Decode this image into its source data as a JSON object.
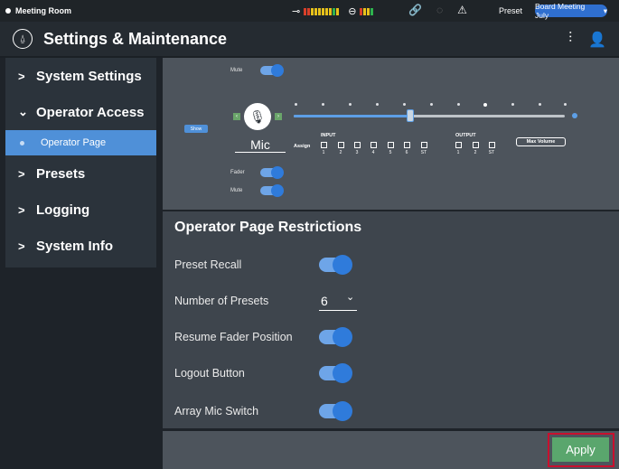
{
  "statusbar": {
    "room_name": "Meeting Room",
    "input_meter_icon": "input-arrow-icon",
    "output_meter_icon": "output-arrow-icon",
    "preset_label": "Preset",
    "preset_value": "Board Meeting July",
    "meter_colors": [
      "#e8c21b",
      "#d9402a",
      "#2fb34d"
    ]
  },
  "header": {
    "title": "Settings & Maintenance",
    "logo_glyph": "⍙"
  },
  "sidebar": {
    "items": [
      {
        "label": "System Settings",
        "chevron": ">"
      },
      {
        "label": "Operator Access",
        "chevron": "⌄"
      },
      {
        "label": "Operator Page"
      },
      {
        "label": "Presets",
        "chevron": ">"
      },
      {
        "label": "Logging",
        "chevron": ">"
      },
      {
        "label": "System Info",
        "chevron": ">"
      }
    ]
  },
  "mic_panel": {
    "mute_label": "Mute",
    "show_label": "Show",
    "mic_name": "Mic",
    "assign_label": "Assign",
    "input_label": "INPUT",
    "output_label": "OUTPUT",
    "input_channels": [
      "1",
      "2",
      "3",
      "4",
      "5",
      "6",
      "ST"
    ],
    "output_channels": [
      "1",
      "2",
      "ST"
    ],
    "max_volume_label": "Max Volume",
    "fader_label": "Fader",
    "mute2_label": "Mute",
    "fader_level_fraction": 0.43
  },
  "restrictions": {
    "title": "Operator Page Restrictions",
    "preset_recall": "Preset Recall",
    "number_of_presets": "Number of Presets",
    "number_value": "6",
    "resume_fader": "Resume Fader Position",
    "logout_button": "Logout Button",
    "array_mic_switch": "Array Mic Switch"
  },
  "footer": {
    "apply_label": "Apply"
  },
  "colors": {
    "accent_blue": "#4f90d8",
    "apply_green": "#5aa66d",
    "highlight_red": "#c8102e"
  }
}
